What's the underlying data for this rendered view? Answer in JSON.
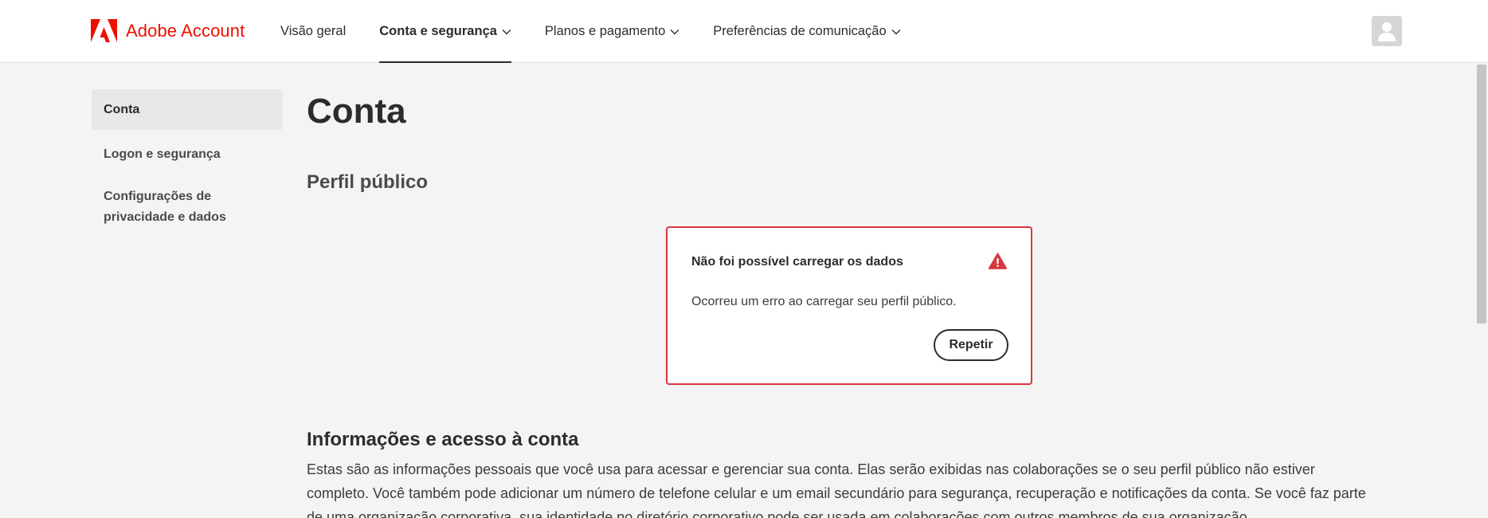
{
  "header": {
    "brand": "Adobe Account",
    "brand_color": "#eb1000",
    "nav": [
      {
        "label": "Visão geral",
        "active": false,
        "dropdown": false
      },
      {
        "label": "Conta e segurança",
        "active": true,
        "dropdown": true
      },
      {
        "label": "Planos e pagamento",
        "active": false,
        "dropdown": true
      },
      {
        "label": "Preferências de comunicação",
        "active": false,
        "dropdown": true
      }
    ],
    "avatar_icon": "user-avatar-icon"
  },
  "sidebar": {
    "items": [
      {
        "label": "Conta",
        "selected": true
      },
      {
        "label": "Logon e segurança",
        "selected": false
      },
      {
        "label": "Configurações de privacidade e dados",
        "selected": false
      }
    ]
  },
  "main": {
    "title": "Conta",
    "profile_heading": "Perfil público",
    "error": {
      "title": "Não foi possível carregar os dados",
      "message": "Ocorreu um erro ao carregar seu perfil público.",
      "retry_label": "Repetir",
      "icon": "warning-icon",
      "color": "#d7373f"
    },
    "info_heading": "Informações e acesso à conta",
    "info_paragraph": "Estas são as informações pessoais que você usa para acessar e gerenciar sua conta. Elas serão exibidas nas colaborações se o seu perfil público não estiver completo. Você também pode adicionar um número de telefone celular e um email secundário para segurança, recuperação e notificações da conta. Se você faz parte de uma organização corporativa, sua identidade no diretório corporativo pode ser usada em colaborações com outros membros de sua organização."
  }
}
